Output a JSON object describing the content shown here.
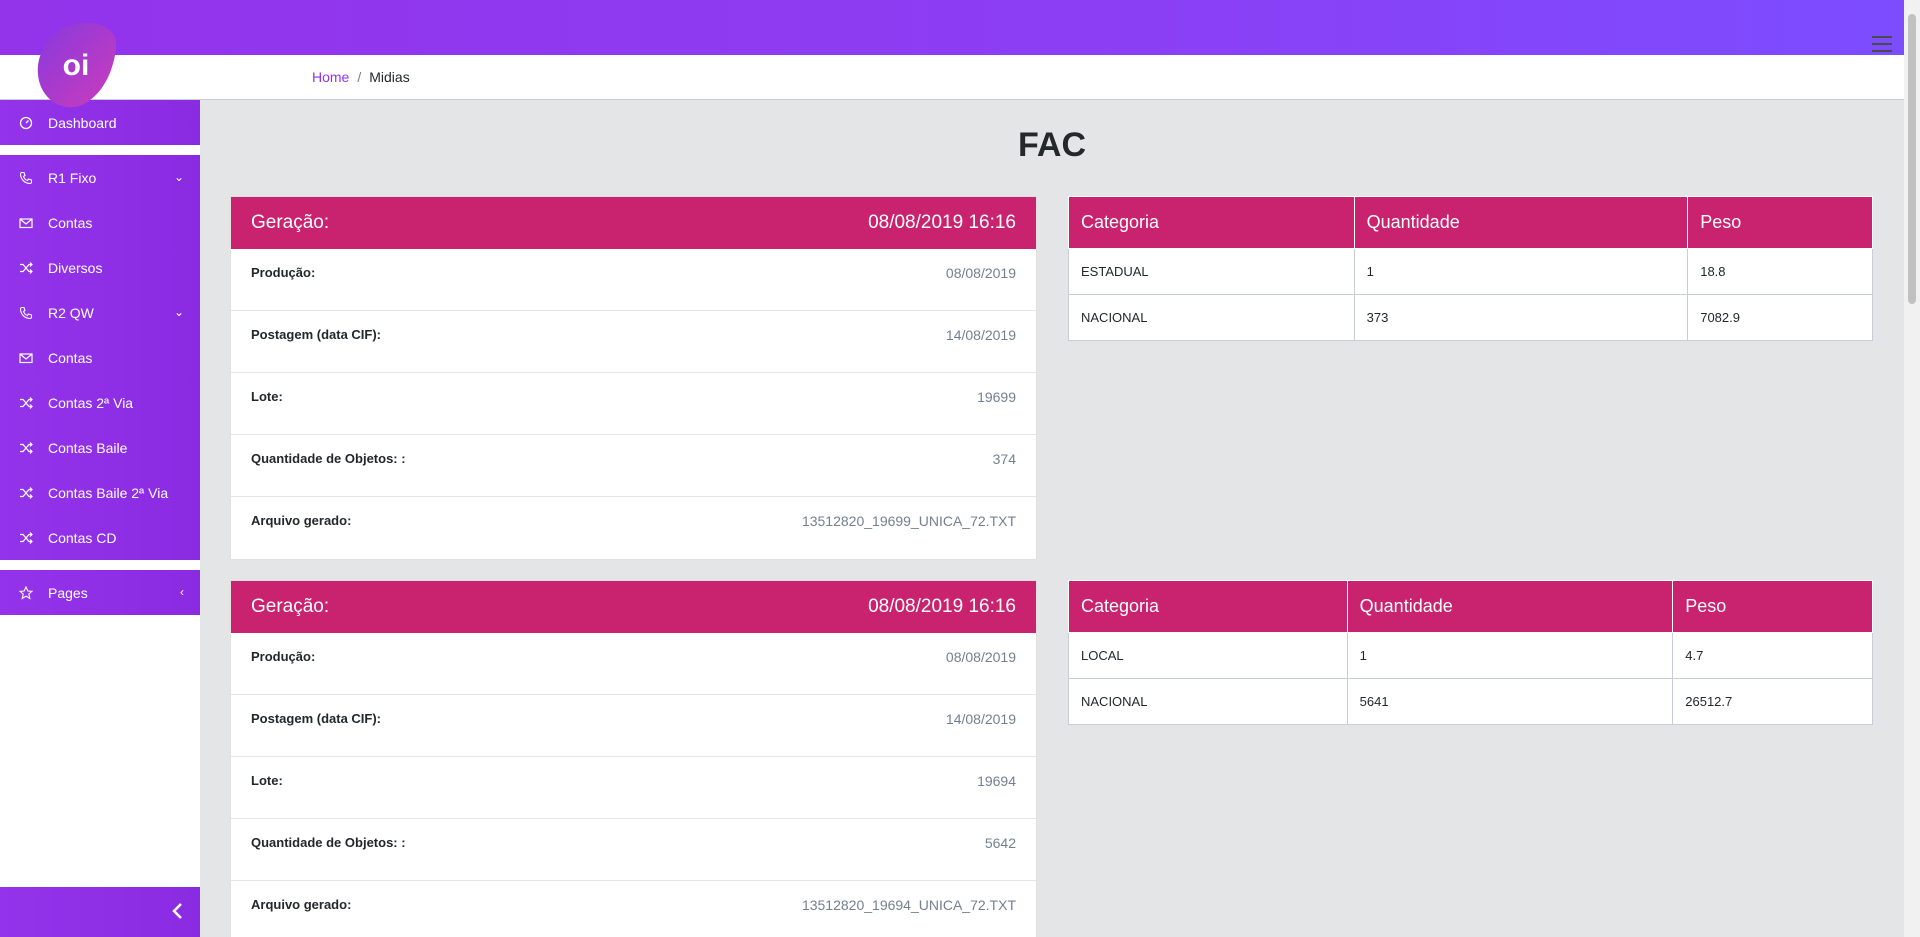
{
  "logo": {
    "text": "oi",
    "color": "#9333ea"
  },
  "breadcrumb": {
    "home": "Home",
    "separator": "/",
    "current": "Midias"
  },
  "sidebar": {
    "items": [
      {
        "label": "Dashboard",
        "icon": "speedometer-icon"
      },
      {
        "label": "R1 Fixo",
        "icon": "phone-icon"
      },
      {
        "label": "Contas",
        "icon": "envelope-icon"
      },
      {
        "label": "Diversos",
        "icon": "shuffle-icon"
      },
      {
        "label": "R2 QW",
        "icon": "phone-icon"
      },
      {
        "label": "Contas",
        "icon": "envelope-icon"
      },
      {
        "label": "Contas 2ª Via",
        "icon": "shuffle-icon"
      },
      {
        "label": "Contas Baile",
        "icon": "shuffle-icon"
      },
      {
        "label": "Contas Baile 2ª Via",
        "icon": "shuffle-icon"
      },
      {
        "label": "Contas CD",
        "icon": "shuffle-icon"
      },
      {
        "label": "Pages",
        "icon": "star-icon"
      }
    ],
    "caret_down": "⌄",
    "caret_left": "‹",
    "minimizer": "‹"
  },
  "page": {
    "title": "FAC"
  },
  "cards": [
    {
      "header_label": "Geração:",
      "header_value": "08/08/2019 16:16",
      "rows": [
        {
          "label": "Produção:",
          "value": "08/08/2019"
        },
        {
          "label": "Postagem (data CIF):",
          "value": "14/08/2019"
        },
        {
          "label": "Lote:",
          "value": "19699"
        },
        {
          "label": "Quantidade de Objetos: :",
          "value": "374"
        },
        {
          "label": "Arquivo gerado:",
          "value": "13512820_19699_UNICA_72.TXT"
        }
      ]
    },
    {
      "header_label": "Geração:",
      "header_value": "08/08/2019 16:16",
      "rows": [
        {
          "label": "Produção:",
          "value": "08/08/2019"
        },
        {
          "label": "Postagem (data CIF):",
          "value": "14/08/2019"
        },
        {
          "label": "Lote:",
          "value": "19694"
        },
        {
          "label": "Quantidade de Objetos: :",
          "value": "5642"
        },
        {
          "label": "Arquivo gerado:",
          "value": "13512820_19694_UNICA_72.TXT"
        }
      ]
    }
  ],
  "tables": [
    {
      "headers": [
        "Categoria",
        "Quantidade",
        "Peso"
      ],
      "rows": [
        [
          "ESTADUAL",
          "1",
          "18.8"
        ],
        [
          "NACIONAL",
          "373",
          "7082.9"
        ]
      ]
    },
    {
      "headers": [
        "Categoria",
        "Quantidade",
        "Peso"
      ],
      "rows": [
        [
          "LOCAL",
          "1",
          "4.7"
        ],
        [
          "NACIONAL",
          "5641",
          "26512.7"
        ]
      ]
    }
  ],
  "colors": {
    "brand_purple": "#9333ea",
    "accent_magenta": "#c9226e",
    "background": "#e4e5e6"
  }
}
